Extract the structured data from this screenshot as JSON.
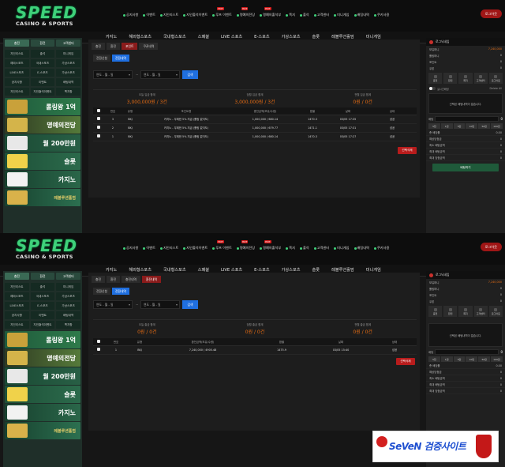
{
  "brand": {
    "logo_main": "SPEED",
    "logo_sub": "CASINO & SPORTS"
  },
  "topnav": {
    "items": [
      "공지사항",
      "이벤트",
      "지인리스트",
      "지인출석이벤트",
      "루프 이벤트",
      "명예의전당",
      "명예의출석부",
      "쪽지",
      "출석",
      "고객센터",
      "미니게임",
      "배팅내역",
      "쿠키사용"
    ],
    "hot": "HOT",
    "logout": "로그아웃"
  },
  "mainnav": [
    "카지노",
    "해외형스포츠",
    "국내형스포츠",
    "스페셜",
    "LIVE 스포츠",
    "E-스포츠",
    "가상스포츠",
    "슬롯",
    "레볼루션홀덤",
    "미니게임"
  ],
  "left": {
    "tabs": [
      "충전",
      "환전",
      "고객센터"
    ],
    "grid": [
      "지인리스트",
      "출석",
      "미니게임",
      "해외스포츠",
      "국내스포츠",
      "가상스포츠",
      "LIVE스포츠",
      "E-스포츠",
      "가상스포츠",
      "공지사항",
      "이벤트",
      "배팅내역",
      "지인리스트",
      "지인출석이벤트",
      "쪽지함"
    ],
    "banners": [
      {
        "title": "롤링왕 1억",
        "sub": ""
      },
      {
        "title": "명예의전당",
        "sub": ""
      },
      {
        "title": "월 200만원",
        "sub": "지인리스트 보너스"
      },
      {
        "title": "슬롯",
        "sub": ""
      },
      {
        "title": "카지노",
        "sub": ""
      },
      {
        "title": "WINNER",
        "sub": "레볼루션홀덤"
      }
    ]
  },
  "shot1": {
    "tabs": [
      "충전",
      "환전",
      "포인트",
      "쿠폰내역"
    ],
    "active_tab": 2,
    "subtabs": [
      "전환신청",
      "전환내역"
    ],
    "date_from": "연도 - 월 - 일",
    "date_sep": "~",
    "date_to": "연도 - 월 - 일",
    "search": "검색",
    "summary": [
      {
        "label": "오늘 입금 합계",
        "value": "3,000,000원 / 3건"
      },
      {
        "label": "당월 입금 합계",
        "value": "3,000,000원 / 3건"
      },
      {
        "label": "전월 입금 합계",
        "value": "0원 / 0건"
      }
    ],
    "columns": [
      "",
      "번호",
      "유형",
      "포인트명",
      "충전금액(보유/수령)",
      "환율",
      "날짜",
      "상태"
    ],
    "rows": [
      [
        "3",
        "BKJ",
        "카지노 - 무제한 5% 지급 (롤링 없이도)",
        "1,000,000 / 680.14",
        "1470.3",
        "03/05 17:35",
        "성공"
      ],
      [
        "2",
        "BKJ",
        "카지노 - 무제한 5% 지급 (롤링 없이도)",
        "1,000,000 / 679.77",
        "1471.1",
        "03/05 17:31",
        "성공"
      ],
      [
        "1",
        "BKJ",
        "카지노 - 무제한 5% 지급 (롤링 없이도)",
        "1,000,000 / 680.14",
        "1470.3",
        "03/05 17:27",
        "성공"
      ]
    ],
    "delete": "선택삭제"
  },
  "shot2": {
    "tabs": [
      "충전",
      "환전",
      "충전내역",
      "환전내역"
    ],
    "active_tab": 3,
    "subtabs": [
      "전환신청",
      "전환내역"
    ],
    "date_from": "연도 - 월 - 일",
    "date_sep": "~",
    "date_to": "연도 - 월 - 일",
    "search": "검색",
    "summary": [
      {
        "label": "오늘 출금 합계",
        "value": "0원 / 0건"
      },
      {
        "label": "당월 출금 합계",
        "value": "0원 / 0건"
      },
      {
        "label": "전월 출금 합계",
        "value": "0원 / 0건"
      }
    ],
    "columns": [
      "",
      "번호",
      "유형",
      "환전금액(보유/수령)",
      "환율",
      "날짜",
      "상태"
    ],
    "rows": [
      [
        "1",
        "BKJ",
        "7,240,000 / 4905.48",
        "1475.9",
        "03/05 15:40",
        "성공"
      ]
    ],
    "delete": "선택삭제"
  },
  "right1": {
    "user": "로그닉네임",
    "rows": [
      {
        "label": "보유머니",
        "value": "7,240,000"
      },
      {
        "label": "롤링머니",
        "value": "0"
      },
      {
        "label": "포인트",
        "value": "0"
      },
      {
        "label": "쿠폰",
        "value": "0"
      }
    ],
    "icons": [
      "충전",
      "환전",
      "쪽지",
      "고객센터",
      "로그아웃"
    ],
    "toggle": "실시간배팅",
    "toggle_right": "Delete All",
    "slip_empty": "선택된 배팅내역이 없습니다.",
    "bet_label": "배팅",
    "bet_count": "0",
    "chips": [
      "5천",
      "1만",
      "5만",
      "10만",
      "50만",
      "100만"
    ],
    "list": [
      {
        "label": "총 배당률",
        "value": "0.00"
      },
      {
        "label": "예상당첨금",
        "value": "0"
      },
      {
        "label": "최소 배팅금액",
        "value": "0"
      },
      {
        "label": "최대 배팅금액",
        "value": "0"
      },
      {
        "label": "최대 당첨금액",
        "value": "0"
      }
    ],
    "bet_button": "배팅하기"
  },
  "right2": {
    "user": "로그닉네임",
    "rows": [
      {
        "label": "보유머니",
        "value": "7,240,000"
      },
      {
        "label": "롤링머니",
        "value": "0"
      },
      {
        "label": "포인트",
        "value": "0"
      },
      {
        "label": "쿠폰",
        "value": "0"
      }
    ],
    "icons": [
      "충전",
      "환전",
      "쪽지",
      "고객센터",
      "로그아웃"
    ],
    "slip_empty": "선택된 배팅내역이 없습니다.",
    "bet_label": "배팅",
    "bet_count": "0",
    "chips": [
      "5천",
      "1만",
      "5만",
      "10만",
      "50만",
      "100만"
    ],
    "list": [
      {
        "label": "총 배당률",
        "value": "0.00"
      },
      {
        "label": "예상당첨금",
        "value": "0"
      },
      {
        "label": "최소 배팅금액",
        "value": "0"
      },
      {
        "label": "최대 배팅금액",
        "value": "0"
      },
      {
        "label": "최대 당첨금액",
        "value": "0"
      }
    ]
  },
  "watermark": {
    "text": "SeVeN 검증사이트"
  }
}
